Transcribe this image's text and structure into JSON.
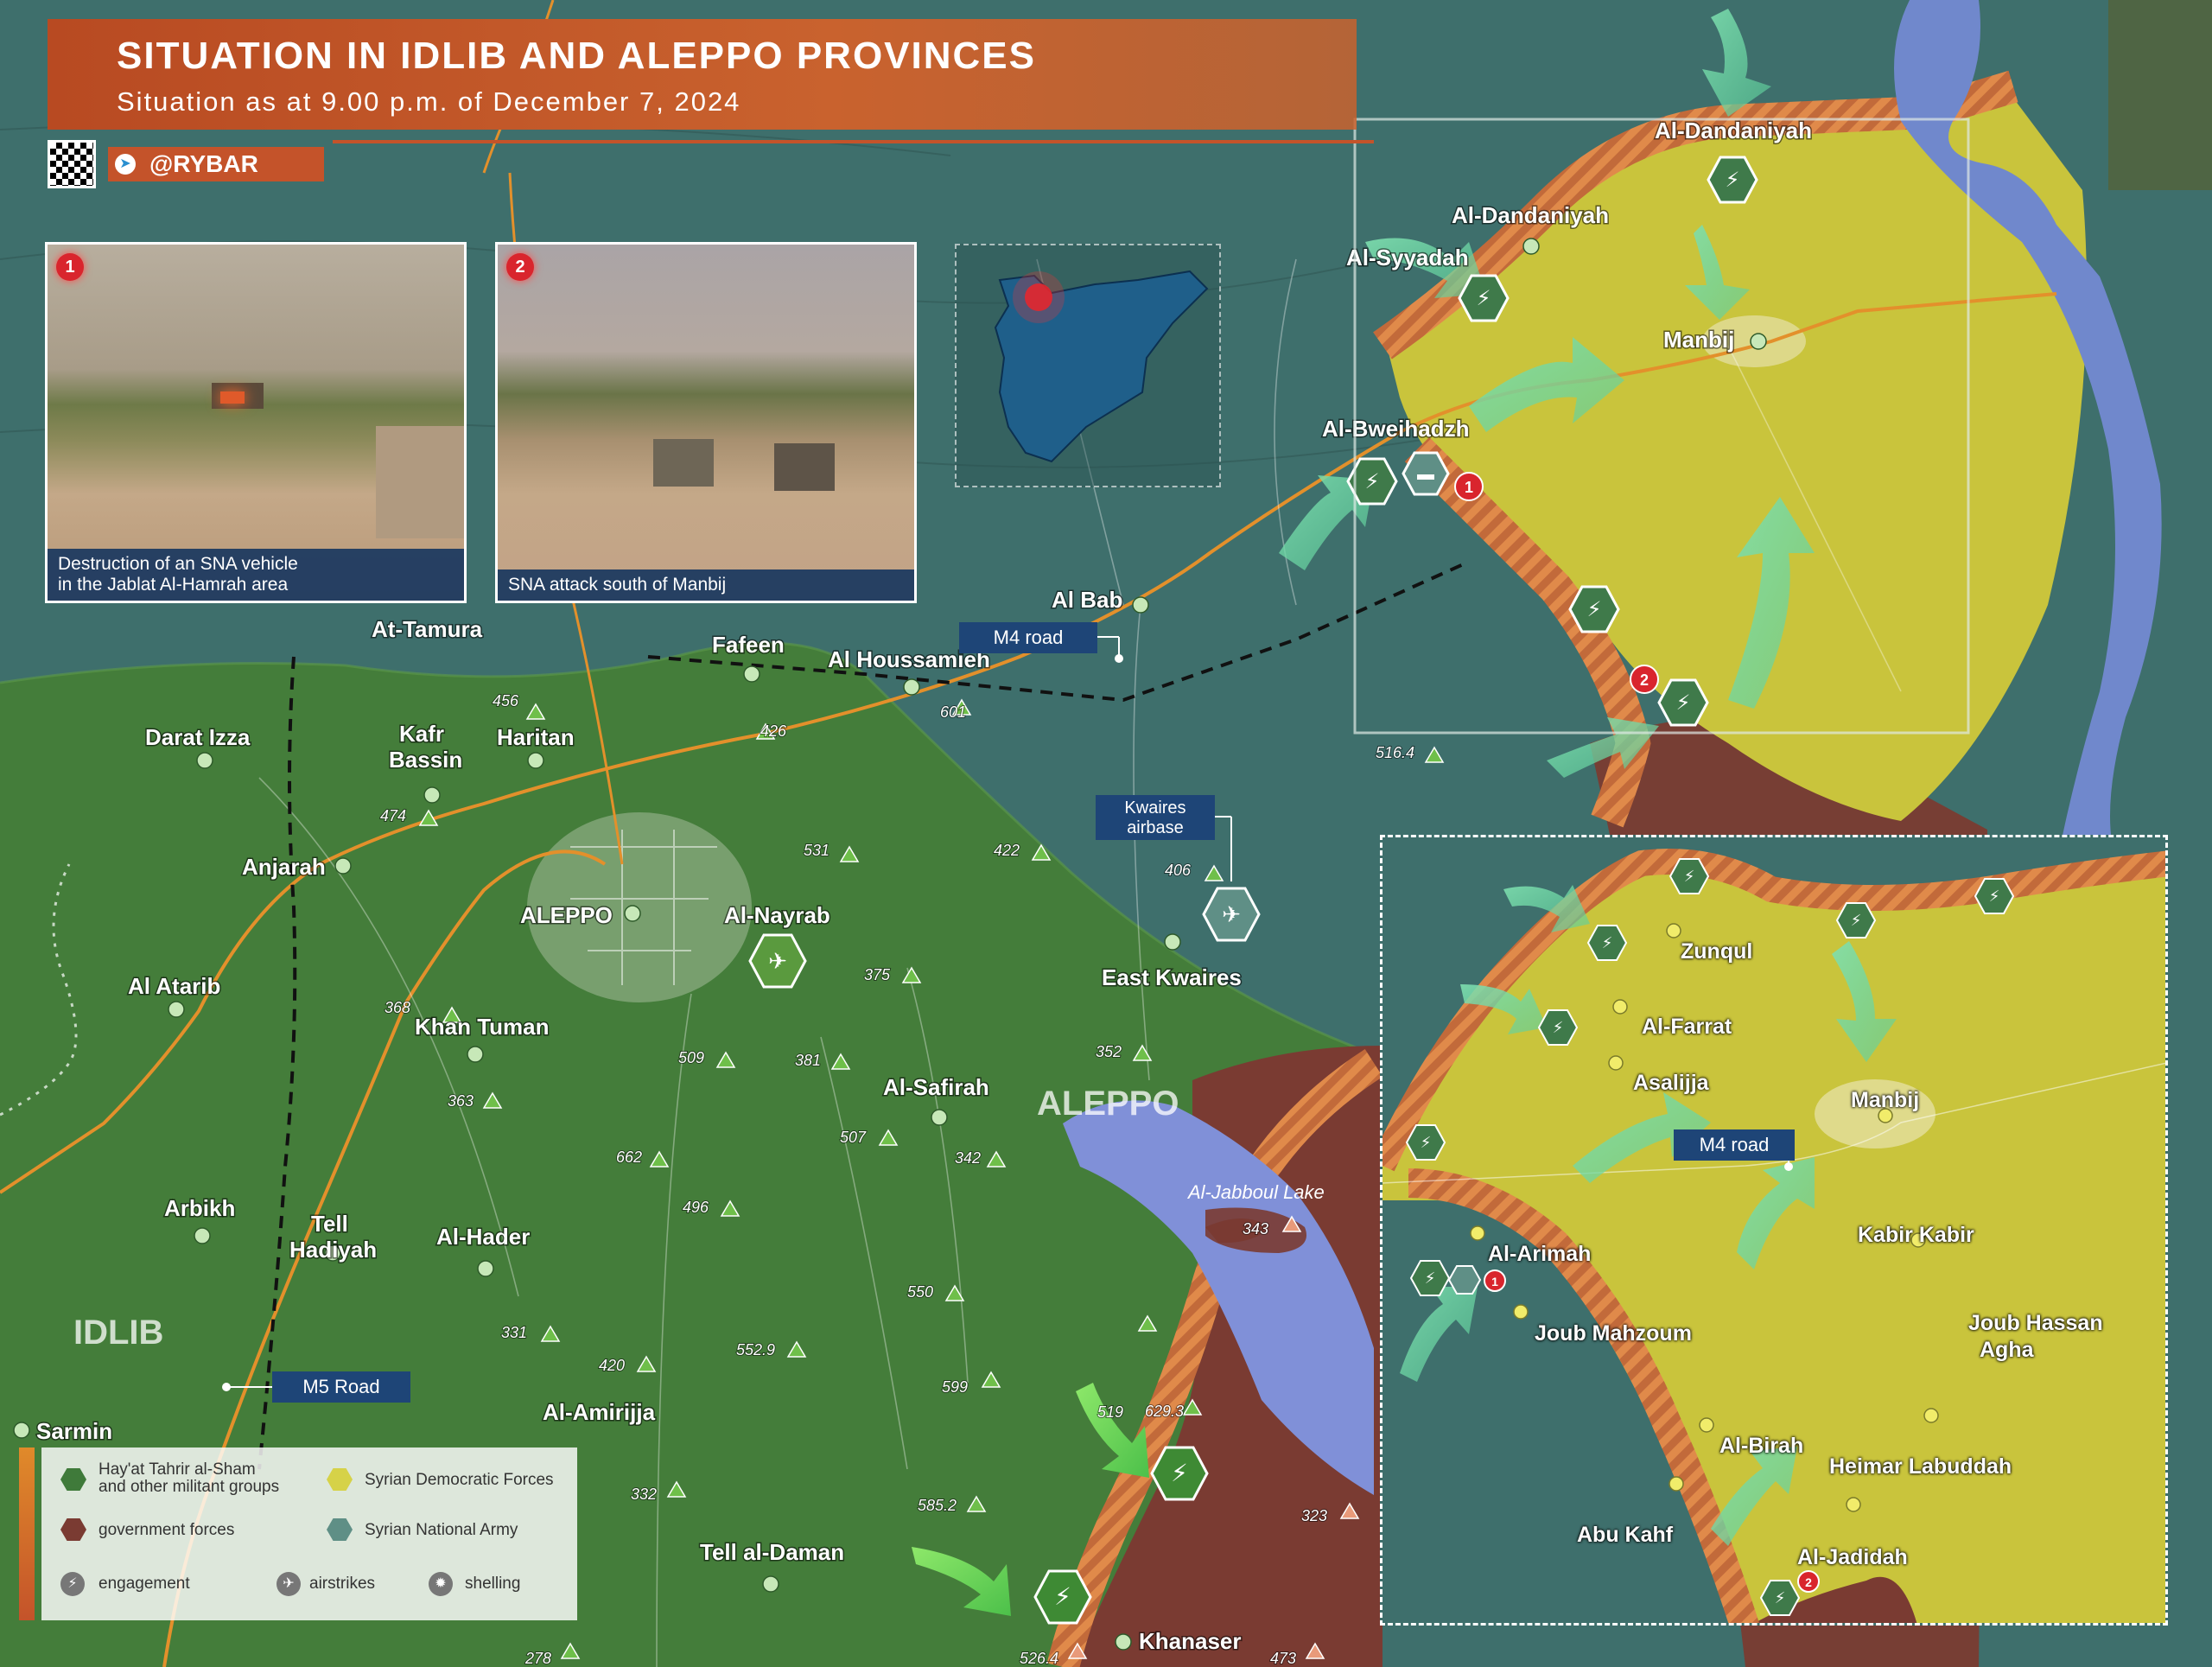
{
  "header": {
    "title": "SITUATION IN IDLIB AND ALEPPO PROVINCES",
    "subtitle": "Situation as at 9.00 p.m. of December 7, 2024",
    "handle": "@RYBAR"
  },
  "photos": [
    {
      "number": "1",
      "caption_line1": "Destruction of an SNA vehicle",
      "caption_line2": "in the Jablat Al-Hamrah area"
    },
    {
      "number": "2",
      "caption_line1": "SNA attack south of Manbij",
      "caption_line2": ""
    }
  ],
  "colors": {
    "hts": "#3f7a3a",
    "sdf": "#c8c43a",
    "government": "#7a3b32",
    "sna": "#3e6f6c",
    "frontline": "#e07a3a",
    "header": "#c4532a",
    "road": "#e3902b",
    "lake": "#8090d8"
  },
  "map": {
    "regions": [
      "IDLIB",
      "ALEPPO"
    ],
    "lake": "Al-Jabboul Lake",
    "roads": [
      "M4 road",
      "M5 Road"
    ],
    "airbase": "Kwaires airbase",
    "places": [
      "Al-Dandaniyah",
      "Al-Dandaniyah",
      "Al-Syyadah",
      "Manbij",
      "Al-Bweihadzh",
      "Al Bab",
      "At-Tamura",
      "Fafeen",
      "Al Houssamieh",
      "Darat Izza",
      "Kafr Bassin",
      "Haritan",
      "Anjarah",
      "ALEPPO",
      "Al-Nayrab",
      "East Kwaires",
      "Al Atarib",
      "Khan Tuman",
      "Al-Safirah",
      "Arbikh",
      "Tell Hadiyah",
      "Al-Hader",
      "Al-Amirijja",
      "Sarmin",
      "Tell al-Daman",
      "Khanaser"
    ],
    "elevations": [
      "456",
      "426",
      "601",
      "516.4",
      "474",
      "531",
      "422",
      "406",
      "375",
      "368",
      "509",
      "381",
      "352",
      "363",
      "507",
      "342",
      "662",
      "496",
      "550",
      "331",
      "420",
      "552.9",
      "519",
      "599",
      "629.3",
      "332",
      "585.2",
      "343",
      "323",
      "278",
      "526.4",
      "473"
    ]
  },
  "inset": {
    "places": [
      "Zunqul",
      "Al-Farrat",
      "Asalijja",
      "Manbij",
      "Al-Arimah",
      "Kabir Kabir",
      "Joub Mahzoum",
      "Joub Hassan",
      "Agha",
      "Al-Birah",
      "Heimar Labuddah",
      "Abu Kahf",
      "Al-Jadidah"
    ],
    "road": "M4 road"
  },
  "legend": {
    "hts_line1": "Hay'at Tahrir al-Sham",
    "hts_line2": "and other militant groups",
    "sdf": "Syrian Democratic Forces",
    "gov": "government forces",
    "sna": "Syrian National Army",
    "engagement": "engagement",
    "airstrikes": "airstrikes",
    "shelling": "shelling"
  }
}
